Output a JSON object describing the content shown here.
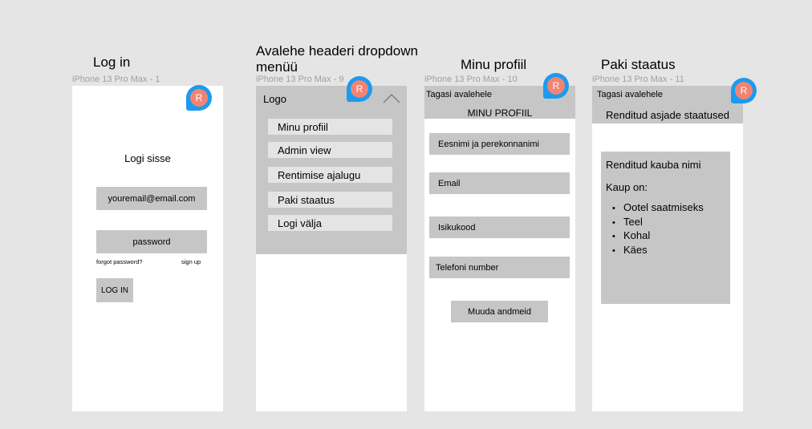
{
  "frames": {
    "login": {
      "title": "Log in",
      "label": "iPhone 13 Pro Max - 1",
      "heading": "Logi sisse",
      "email_value": "youremail@email.com",
      "password_value": "password",
      "forgot": "forgot password?",
      "signup": "sign up",
      "login_button": "LOG IN",
      "avatar": "R"
    },
    "dropdown": {
      "title_line1": "Avalehe headeri dropdown",
      "title_line2": "menüü",
      "label": "iPhone 13 Pro Max - 9",
      "logo": "Logo",
      "avatar": "R",
      "menu": [
        "Minu profiil",
        "Admin view",
        "Rentimise ajalugu",
        "Paki staatus",
        "Logi välja"
      ]
    },
    "profile": {
      "title": "Minu profiil",
      "label": "iPhone 13 Pro Max - 10",
      "back": "Tagasi avalehele",
      "heading": "MINU PROFIIL",
      "avatar": "R",
      "fields": [
        "Eesnimi ja perekonnanimi",
        "Email",
        "Isikukood",
        "Telefoni number"
      ],
      "button": "Muuda andmeid"
    },
    "status": {
      "title": "Paki staatus",
      "label": "iPhone 13 Pro Max - 11",
      "back": "Tagasi avalehele",
      "heading": "Renditud asjade staatused",
      "avatar": "R",
      "item_name": "Renditud kauba nimi",
      "state_label": "Kaup on:",
      "states": [
        "Ootel saatmiseks",
        "Teel",
        "Kohal",
        "Käes"
      ]
    }
  },
  "colors": {
    "canvas": "#e5e5e5",
    "placeholder_box": "#c6c6c6",
    "avatar_ring": "#1a9bf0",
    "avatar_fill": "#f28373"
  }
}
